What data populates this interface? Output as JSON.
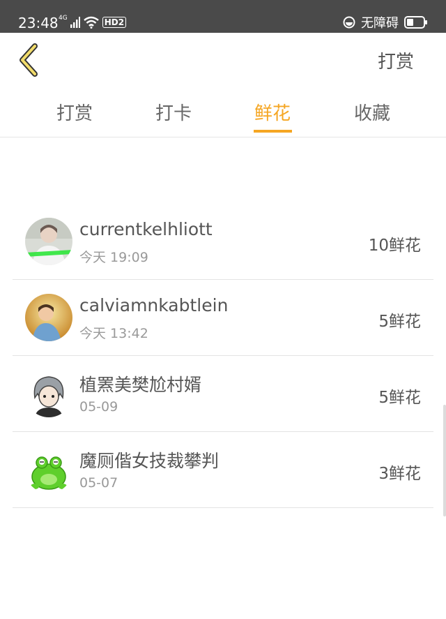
{
  "status_bar": {
    "time": "23:48",
    "network_label": "4G",
    "hd_label": "HD2",
    "accessibility_label": "无障碍"
  },
  "header": {
    "action_label": "打赏"
  },
  "tabs": [
    {
      "label": "打赏",
      "active": false
    },
    {
      "label": "打卡",
      "active": false
    },
    {
      "label": "鲜花",
      "active": true
    },
    {
      "label": "收藏",
      "active": false
    }
  ],
  "list": [
    {
      "name": "currentkelhliott",
      "time": "今天 19:09",
      "amount": "10鲜花",
      "avatar": "person-photo-avatar"
    },
    {
      "name": "calviamnkabtlein",
      "time": "今天 13:42",
      "amount": "5鲜花",
      "avatar": "child-photo-avatar"
    },
    {
      "name": "植罴美樊尬村婿",
      "time": "05-09",
      "amount": "5鲜花",
      "avatar": "anime-character-avatar"
    },
    {
      "name": "魔厕偕女技裁攀判",
      "time": "05-07",
      "amount": "3鲜花",
      "avatar": "green-frog-avatar"
    }
  ],
  "colors": {
    "accent": "#f5a623",
    "status_bar": "#4a4a4a",
    "divider": "#e3e3e3"
  }
}
